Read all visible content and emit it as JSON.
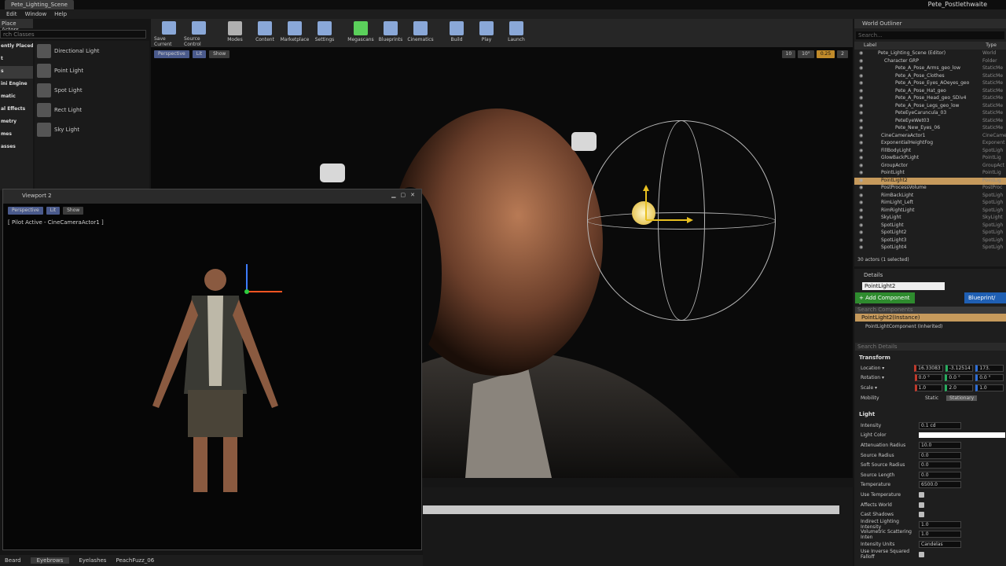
{
  "window": {
    "tab": "Pete_Lighting_Scene",
    "user": "Pete_Postlethwaite"
  },
  "menu": [
    "Edit",
    "Window",
    "Help"
  ],
  "toolbar": [
    {
      "label": "Save Current",
      "icon": "save-icon",
      "color": "#8aa8d8"
    },
    {
      "label": "Source Control",
      "icon": "source-control-icon",
      "color": "#8aa8d8"
    },
    {
      "label": "Modes",
      "icon": "modes-icon",
      "color": "#b0b0b0"
    },
    {
      "label": "Content",
      "icon": "content-icon",
      "color": "#8aa8d8"
    },
    {
      "label": "Marketplace",
      "icon": "marketplace-icon",
      "color": "#8aa8d8"
    },
    {
      "label": "Settings",
      "icon": "settings-icon",
      "color": "#8aa8d8"
    },
    {
      "label": "Megascans",
      "icon": "megascans-icon",
      "color": "#5bd05b"
    },
    {
      "label": "Blueprints",
      "icon": "blueprints-icon",
      "color": "#8aa8d8"
    },
    {
      "label": "Cinematics",
      "icon": "cinematics-icon",
      "color": "#8aa8d8"
    },
    {
      "label": "Build",
      "icon": "build-icon",
      "color": "#8aa8d8"
    },
    {
      "label": "Play",
      "icon": "play-icon",
      "color": "#8aa8d8"
    },
    {
      "label": "Launch",
      "icon": "launch-icon",
      "color": "#8aa8d8"
    }
  ],
  "place_actors": {
    "header": "Place Actors",
    "search_placeholder": "rch Classes",
    "categories": [
      "ently Placed",
      "t",
      "s",
      "ini Engine",
      "matic",
      "al Effects",
      "metry",
      "mes",
      "asses"
    ],
    "items": [
      "Directional Light",
      "Point Light",
      "Spot Light",
      "Rect Light",
      "Sky Light"
    ]
  },
  "viewport": {
    "perspective": "Perspective",
    "lit": "Lit",
    "show": "Show",
    "right_values": [
      "10",
      "10°",
      "0.25",
      "2"
    ]
  },
  "viewport2": {
    "title": "Viewport 2",
    "perspective": "Perspective",
    "lit": "Lit",
    "show": "Show",
    "pilot": "[ Pilot Active - CineCameraActor1 ]"
  },
  "bottom_tabs": [
    "Beard",
    "Eyebrows",
    "Eyelashes",
    "PeachFuzz_06"
  ],
  "outliner": {
    "header": "World Outliner",
    "search_placeholder": "Search...",
    "col_label": "Label",
    "col_type": "Type",
    "rows": [
      {
        "name": "Pete_Lighting_Scene (Editor)",
        "type": "World"
      },
      {
        "name": "Character GRP",
        "type": "Folder"
      },
      {
        "name": "Pete_A_Pose_Arms_geo_low",
        "type": "StaticMe"
      },
      {
        "name": "Pete_A_Pose_Clothes",
        "type": "StaticMe"
      },
      {
        "name": "Pete_A_Pose_Eyes_AOeyes_geo",
        "type": "StaticMe"
      },
      {
        "name": "Pete_A_Pose_Hat_geo",
        "type": "StaticMe"
      },
      {
        "name": "Pete_A_Pose_Head_geo_SDiv4",
        "type": "StaticMe"
      },
      {
        "name": "Pete_A_Pose_Legs_geo_low",
        "type": "StaticMe"
      },
      {
        "name": "PeteEyeCaruncula_03",
        "type": "StaticMe"
      },
      {
        "name": "PeteEyeWet03",
        "type": "StaticMe"
      },
      {
        "name": "Pete_New_Eyes_06",
        "type": "StaticMe"
      },
      {
        "name": "CineCameraActor1",
        "type": "CineCame"
      },
      {
        "name": "ExponentialHeightFog",
        "type": "Exponent"
      },
      {
        "name": "FillBodyLight",
        "type": "SpotLigh"
      },
      {
        "name": "GlowBackPLight",
        "type": "PointLig"
      },
      {
        "name": "GroupActor",
        "type": "GroupAct"
      },
      {
        "name": "PointLight",
        "type": "PointLig"
      },
      {
        "name": "PointLight2",
        "type": "PointLig",
        "selected": true
      },
      {
        "name": "PostProcessVolume",
        "type": "PostProc"
      },
      {
        "name": "RimBackLight",
        "type": "SpotLigh"
      },
      {
        "name": "RimLight_Left",
        "type": "SpotLigh"
      },
      {
        "name": "RimRightLight",
        "type": "SpotLigh"
      },
      {
        "name": "SkyLight",
        "type": "SkyLight"
      },
      {
        "name": "SpotLight",
        "type": "SpotLigh"
      },
      {
        "name": "SpotLight2",
        "type": "SpotLigh"
      },
      {
        "name": "SpotLight3",
        "type": "SpotLigh"
      },
      {
        "name": "SpotLight4",
        "type": "SpotLigh"
      }
    ],
    "count": "30 actors (1 selected)"
  },
  "details": {
    "header": "Details",
    "name": "PointLight2",
    "add_component": "+ Add Component -",
    "blueprint": "Blueprint/",
    "comp_search": "Search Components",
    "comp_selected": "PointLight2(Instance)",
    "comp_child": "PointLightComponent (Inherited)",
    "detail_search": "Search Details",
    "transform_title": "Transform",
    "transform": [
      {
        "label": "Location ▾",
        "values": [
          "16.33083",
          "-3.12514",
          "173."
        ]
      },
      {
        "label": "Rotation ▾",
        "values": [
          "0.0 °",
          "0.0 °",
          "0.0 °"
        ]
      },
      {
        "label": "Scale ▾",
        "values": [
          "1.0",
          "2.0",
          "1.0"
        ]
      }
    ],
    "mobility_label": "Mobility",
    "mobility": [
      "Static",
      "Stationary"
    ],
    "light_title": "Light",
    "light": [
      {
        "label": "Intensity",
        "value": "0.1 cd"
      },
      {
        "label": "Light Color",
        "value": ""
      },
      {
        "label": "Attenuation Radius",
        "value": "10.0"
      },
      {
        "label": "Source Radius",
        "value": "0.0"
      },
      {
        "label": "Soft Source Radius",
        "value": "0.0"
      },
      {
        "label": "Source Length",
        "value": "0.0"
      },
      {
        "label": "Temperature",
        "value": "6500.0"
      },
      {
        "label": "Use Temperature",
        "check": true
      },
      {
        "label": "Affects World",
        "check": true
      },
      {
        "label": "Cast Shadows",
        "check": true
      },
      {
        "label": "Indirect Lighting Intensity",
        "value": "1.0"
      },
      {
        "label": "Volumetric Scattering Inten",
        "value": "1.0"
      },
      {
        "label": "Intensity Units",
        "value": "Candelas"
      },
      {
        "label": "Use Inverse Squared Falloff",
        "check": true
      }
    ]
  }
}
